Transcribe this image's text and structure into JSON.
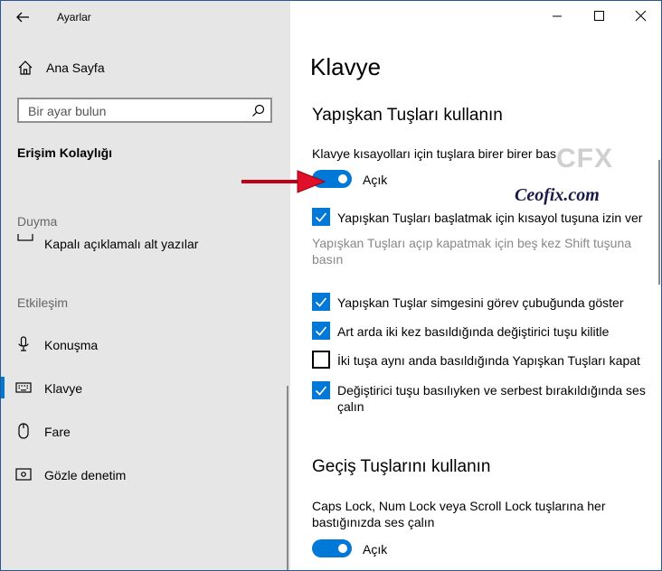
{
  "window": {
    "app_title": "Ayarlar"
  },
  "sidebar": {
    "home_label": "Ana Sayfa",
    "search_placeholder": "Bir ayar bulun",
    "section_title": "Erişim Kolaylığı",
    "group_hearing": "Duyma",
    "item_captions": "Kapalı açıklamalı alt yazılar",
    "group_interaction": "Etkileşim",
    "items": [
      {
        "label": "Konuşma",
        "icon": "microphone-icon"
      },
      {
        "label": "Klavye",
        "icon": "keyboard-icon",
        "active": true
      },
      {
        "label": "Fare",
        "icon": "mouse-icon"
      },
      {
        "label": "Gözle denetim",
        "icon": "eye-control-icon"
      }
    ]
  },
  "main": {
    "page_title": "Klavye",
    "sticky": {
      "heading": "Yapışkan Tuşları kullanın",
      "subtext": "Klavye kısayolları için tuşlara birer birer bas",
      "toggle_label": "Açık",
      "toggle_on": true,
      "shortcut_option": "Yapışkan Tuşları başlatmak için kısayol tuşuna izin ver",
      "shortcut_desc": "Yapışkan Tuşları açıp kapatmak için beş kez Shift tuşuna basın",
      "options": [
        {
          "label": "Yapışkan Tuşlar simgesini görev çubuğunda göster",
          "checked": true
        },
        {
          "label": "Art arda iki kez basıldığında değiştirici tuşu kilitle",
          "checked": true
        },
        {
          "label": "İki tuşa aynı anda basıldığında Yapışkan Tuşları kapat",
          "checked": false
        },
        {
          "label": "Değiştirici tuşu basılıyken ve serbest bırakıldığında ses çalın",
          "checked": true
        }
      ]
    },
    "toggle_keys": {
      "heading": "Geçiş Tuşlarını kullanın",
      "subtext": "Caps Lock, Num Lock veya Scroll Lock tuşlarına her bastığınızda ses çalın",
      "toggle_label": "Açık",
      "toggle_on": true
    }
  },
  "watermark": {
    "logo": "CFX",
    "text": "Ceofix.com"
  },
  "colors": {
    "accent": "#0078d7",
    "sidebar_bg": "#e6e6e6",
    "arrow": "#e0102a"
  }
}
